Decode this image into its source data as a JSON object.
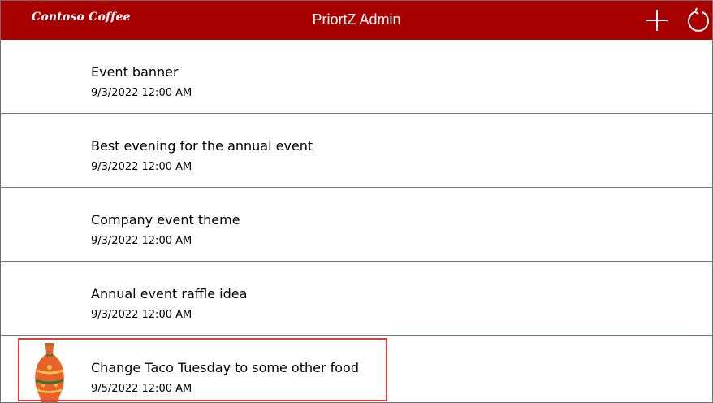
{
  "header": {
    "logo_text": "Contoso Coffee",
    "title": "PriortZ Admin",
    "add_icon": "plus-icon",
    "refresh_icon": "refresh-icon",
    "background_color": "#a80000"
  },
  "items": [
    {
      "title": "Event banner",
      "date": "9/3/2022 12:00 AM"
    },
    {
      "title": "Best evening for the annual event",
      "date": "9/3/2022 12:00 AM"
    },
    {
      "title": "Company event theme",
      "date": "9/3/2022 12:00 AM"
    },
    {
      "title": "Annual event raffle idea",
      "date": "9/3/2022 12:00 AM"
    },
    {
      "title": "Change Taco Tuesday to some other food",
      "date": "9/5/2022 12:00 AM",
      "thumbnail": "vase-image",
      "highlighted": true
    }
  ],
  "colors": {
    "highlight_border": "#e03c3c",
    "divider": "#6f7a9a"
  }
}
